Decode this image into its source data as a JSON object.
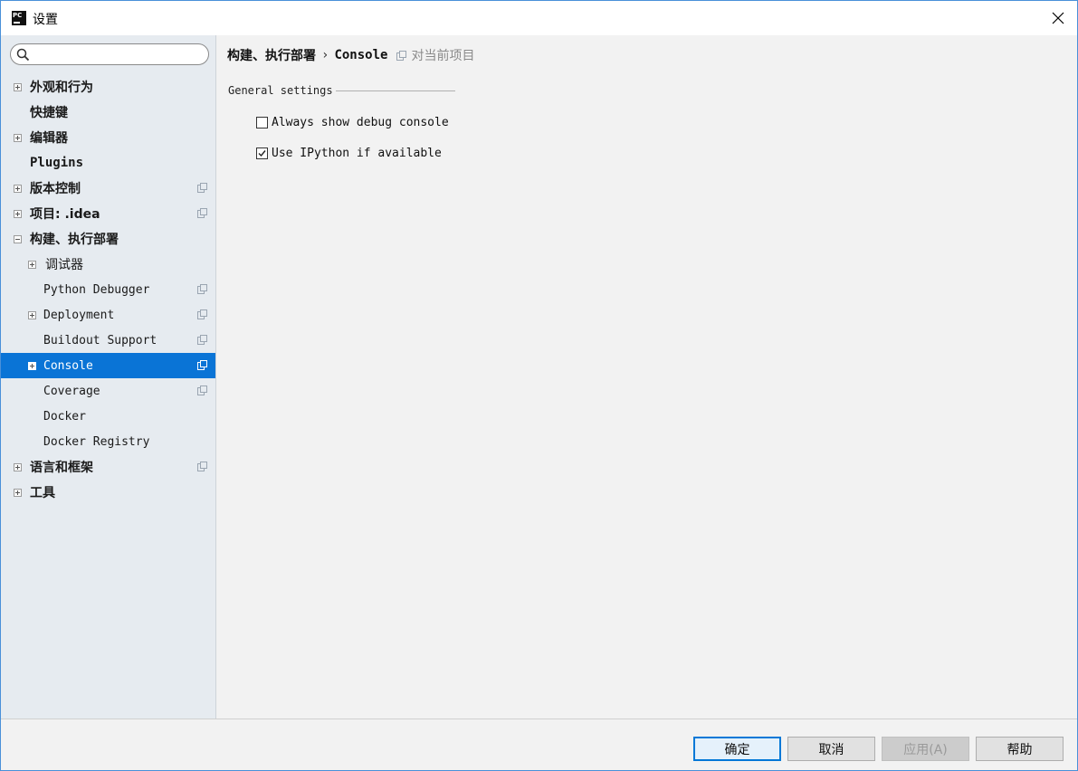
{
  "window": {
    "title": "设置",
    "app_icon_text": "PC"
  },
  "sidebar": {
    "search": {
      "value": "",
      "placeholder": ""
    },
    "items": [
      {
        "label": "外观和行为",
        "expander": "plus",
        "level": 0,
        "style": "bold",
        "project_icon": false
      },
      {
        "label": "快捷键",
        "expander": "none",
        "level": 0,
        "style": "bold",
        "project_icon": false
      },
      {
        "label": "编辑器",
        "expander": "plus",
        "level": 0,
        "style": "bold",
        "project_icon": false
      },
      {
        "label": "Plugins",
        "expander": "none",
        "level": 0,
        "style": "plugins",
        "project_icon": false
      },
      {
        "label": "版本控制",
        "expander": "plus",
        "level": 0,
        "style": "bold",
        "project_icon": true
      },
      {
        "label": "项目: .idea",
        "expander": "plus",
        "level": 0,
        "style": "bold",
        "project_icon": true
      },
      {
        "label": "构建、执行部署",
        "expander": "minus",
        "level": 0,
        "style": "bold",
        "project_icon": false
      },
      {
        "label": "调试器",
        "expander": "plus",
        "level": 1,
        "style": "cjk",
        "project_icon": false
      },
      {
        "label": "Python Debugger",
        "expander": "none",
        "level": 1,
        "style": "mono",
        "project_icon": true
      },
      {
        "label": "Deployment",
        "expander": "plus",
        "level": 1,
        "style": "mono",
        "project_icon": true
      },
      {
        "label": "Buildout Support",
        "expander": "none",
        "level": 1,
        "style": "mono",
        "project_icon": true
      },
      {
        "label": "Console",
        "expander": "plus",
        "level": 1,
        "style": "mono",
        "project_icon": true,
        "selected": true
      },
      {
        "label": "Coverage",
        "expander": "none",
        "level": 1,
        "style": "mono",
        "project_icon": true
      },
      {
        "label": "Docker",
        "expander": "none",
        "level": 1,
        "style": "mono",
        "project_icon": false
      },
      {
        "label": "Docker Registry",
        "expander": "none",
        "level": 1,
        "style": "mono",
        "project_icon": false
      },
      {
        "label": "语言和框架",
        "expander": "plus",
        "level": 0,
        "style": "bold",
        "project_icon": true
      },
      {
        "label": "工具",
        "expander": "plus",
        "level": 0,
        "style": "bold",
        "project_icon": false
      }
    ]
  },
  "content": {
    "breadcrumb": {
      "parent": "构建、执行部署",
      "separator": "›",
      "current": "Console",
      "scope_label": "对当前项目"
    },
    "group_title": "General settings",
    "options": [
      {
        "label": "Always show debug console",
        "checked": false
      },
      {
        "label": "Use IPython if available",
        "checked": true
      }
    ]
  },
  "buttons": {
    "ok": "确定",
    "cancel": "取消",
    "apply": "应用(A)",
    "apply_mnemonic": "A",
    "help": "帮助"
  },
  "colors": {
    "selection": "#0a74d6",
    "sidebar_bg": "#e6ebf0",
    "content_bg": "#f2f2f2"
  }
}
